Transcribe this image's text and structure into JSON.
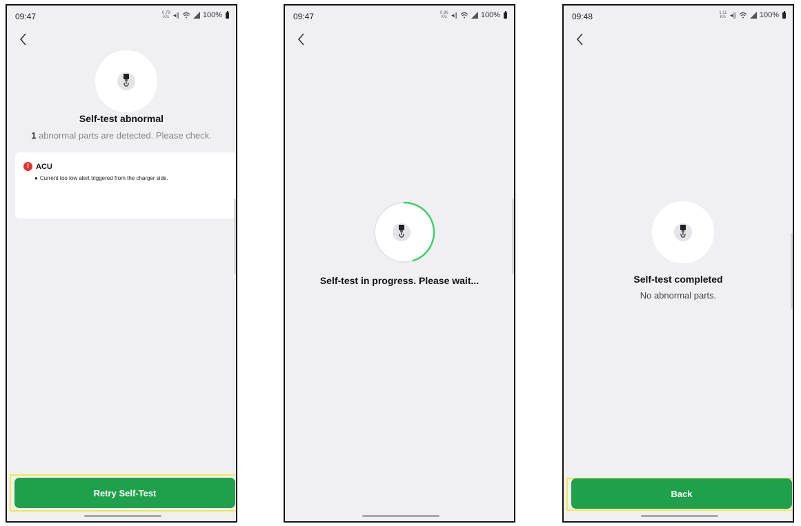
{
  "screens": [
    {
      "time": "09:47",
      "net_speed": "0.79\nK/s",
      "battery": "100%",
      "title": "Self-test abnormal",
      "summary_count": "1",
      "summary_text": "abnormal parts are detected. Please check.",
      "error": {
        "component": "ACU",
        "issues": [
          "Current too low alert triggered from the charger side."
        ],
        "icon": "exclamation-icon",
        "color": "#e5322d"
      },
      "button_label": "Retry Self-Test"
    },
    {
      "time": "09:47",
      "net_speed": "0.96\nK/s",
      "battery": "100%",
      "title": "Self-test in progress. Please wait...",
      "progress_ring": {
        "color": "#3dcf6e",
        "track": "#e4e4e8"
      }
    },
    {
      "time": "09:48",
      "net_speed": "1.11\nK/s",
      "battery": "100%",
      "title": "Self-test completed",
      "subtitle": "No abnormal parts.",
      "button_label": "Back"
    }
  ],
  "colors": {
    "accent_green": "#1fa04a",
    "highlight_border": "#f3e84a",
    "background": "#f0f0f3"
  },
  "icons": [
    "back-arrow-icon",
    "charger-icon",
    "wifi-icon",
    "cellular-signal-icon",
    "battery-icon",
    "sim-signal-icon"
  ]
}
